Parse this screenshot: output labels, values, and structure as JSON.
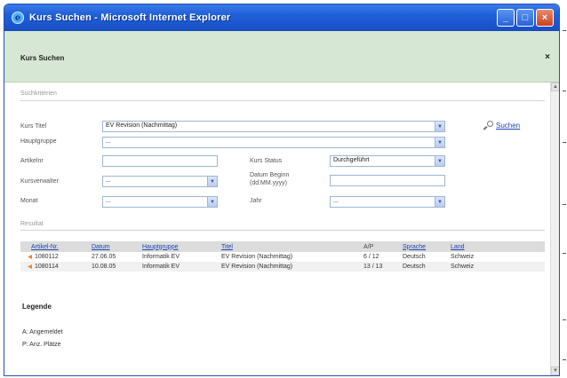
{
  "window": {
    "title": "Kurs Suchen - Microsoft Internet Explorer",
    "icon": "ie-icon",
    "controls": [
      "minimize-icon",
      "maximize-icon",
      "close-icon"
    ]
  },
  "dialog": {
    "title": "Kurs Suchen",
    "close": "×"
  },
  "criteria": {
    "section_label": "Suchkriterien",
    "kurs_titel_label": "Kurs Titel",
    "kurs_titel_value": "EV Revision (Nachmittag)",
    "hauptgruppe_label": "Hauptgruppe",
    "hauptgruppe_value": "...",
    "artikelnr_label": "Artikelnr",
    "artikelnr_value": "",
    "kurs_status_label": "Kurs Status",
    "kurs_status_value": "Durchgeführt",
    "kursverwalter_label": "Kursverwalter",
    "kursverwalter_value": "...",
    "datum_beginn_label_1": "Datum Beginn",
    "datum_beginn_label_2": "(dd.MM.yyyy)",
    "datum_beginn_value": "",
    "monat_label": "Monat",
    "monat_value": "...",
    "jahr_label": "Jahr",
    "jahr_value": "...",
    "search_label": "Suchen"
  },
  "results": {
    "section_label": "Resultat",
    "columns": [
      "Artikel-Nr.",
      "Datum",
      "Hauptgruppe",
      "Titel",
      "A/P",
      "Sprache",
      "Land"
    ],
    "rows": [
      {
        "nr": "1080112",
        "datum": "27.06.05",
        "hauptgruppe": "Informatik EV",
        "titel": "EV Revision (Nachmittag)",
        "ap": "6 / 12",
        "sprache": "Deutsch",
        "land": "Schweiz"
      },
      {
        "nr": "1080114",
        "datum": "10.08.05",
        "hauptgruppe": "Informatik EV",
        "titel": "EV Revision (Nachmittag)",
        "ap": "13 / 13",
        "sprache": "Deutsch",
        "land": "Schweiz"
      }
    ]
  },
  "legend": {
    "title": "Legende",
    "items": [
      "A: Angemeldet",
      "P: Anz. Plätze"
    ]
  }
}
